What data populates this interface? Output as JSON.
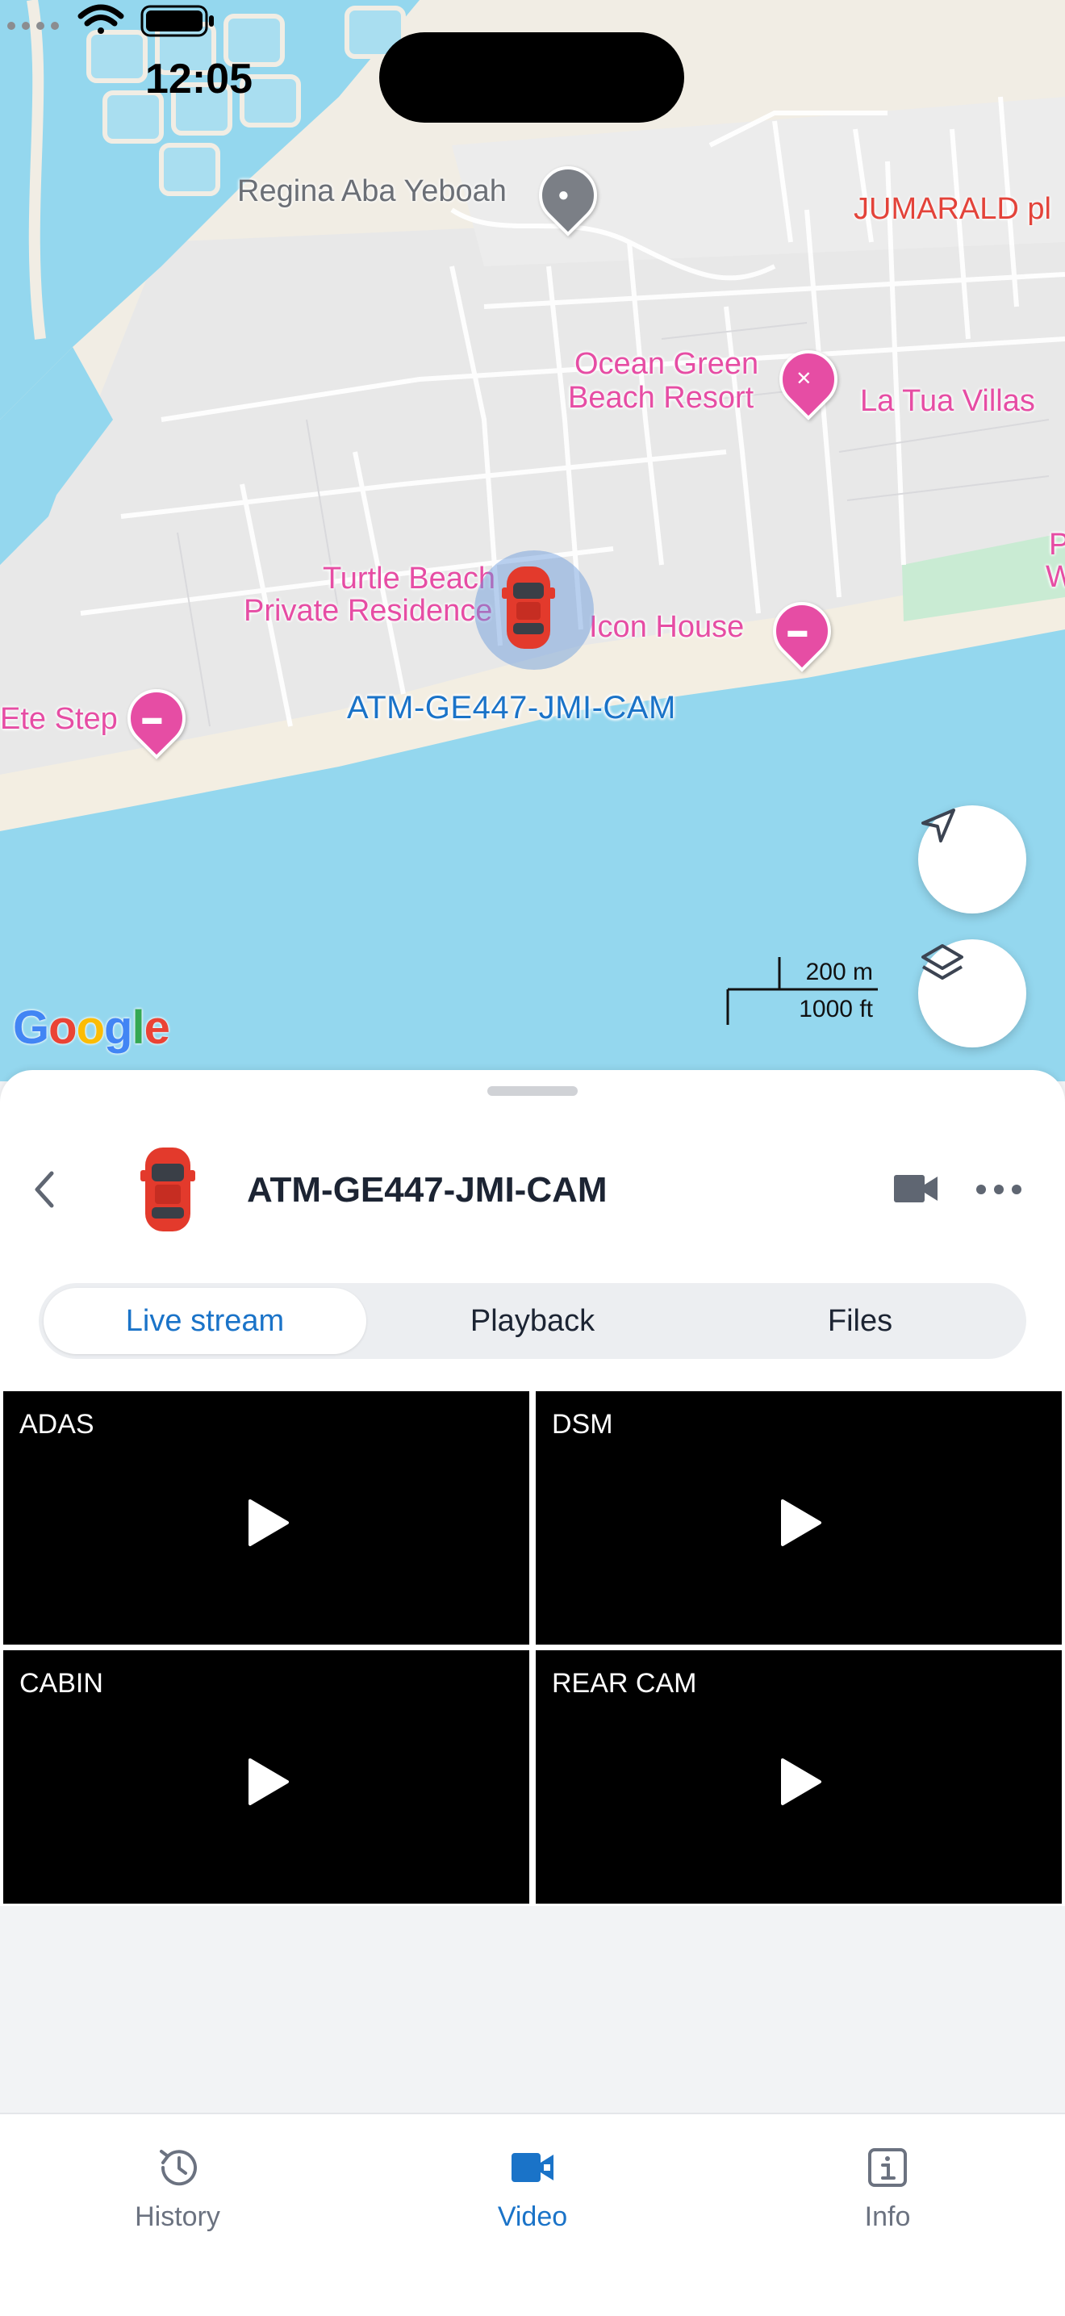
{
  "status_bar": {
    "time": "12:05"
  },
  "map": {
    "pois": [
      {
        "name": "Regina Aba Yeboah",
        "style": "gray"
      },
      {
        "name": "JUMARALD pl",
        "style": "red"
      },
      {
        "name_line1": "Ocean Green",
        "name_line2": "Beach Resort",
        "style": "pink"
      },
      {
        "name": "La Tua Villas",
        "style": "pink"
      },
      {
        "name_line1": "Turtle Beach",
        "name_line2": "Private Residence",
        "style": "pink"
      },
      {
        "name": "Icon House",
        "style": "pink"
      },
      {
        "name": "Ete Step",
        "style": "pink"
      },
      {
        "name_line1": "P",
        "name_line2": "W",
        "style": "pink"
      }
    ],
    "device_label": "ATM-GE447-JMI-CAM",
    "scale": {
      "metric": "200 m",
      "imperial": "1000 ft"
    },
    "attribution": "Google",
    "colors": {
      "water": "#94d7ee",
      "land": "#f1ede4",
      "urban": "#e9e9ea",
      "beach": "#f3eee2",
      "poi": "#e64da4",
      "accent": "#1a73c8"
    }
  },
  "sheet": {
    "device_name": "ATM-GE447-JMI-CAM",
    "tabs": [
      {
        "label": "Live stream",
        "active": true
      },
      {
        "label": "Playback",
        "active": false
      },
      {
        "label": "Files",
        "active": false
      }
    ],
    "cameras": [
      {
        "label": "ADAS"
      },
      {
        "label": "DSM"
      },
      {
        "label": "CABIN"
      },
      {
        "label": "REAR CAM"
      }
    ]
  },
  "tabbar": {
    "items": [
      {
        "label": "History",
        "icon": "history-icon",
        "active": false
      },
      {
        "label": "Video",
        "icon": "video-camera-icon",
        "active": true
      },
      {
        "label": "Info",
        "icon": "info-icon",
        "active": false
      }
    ]
  }
}
